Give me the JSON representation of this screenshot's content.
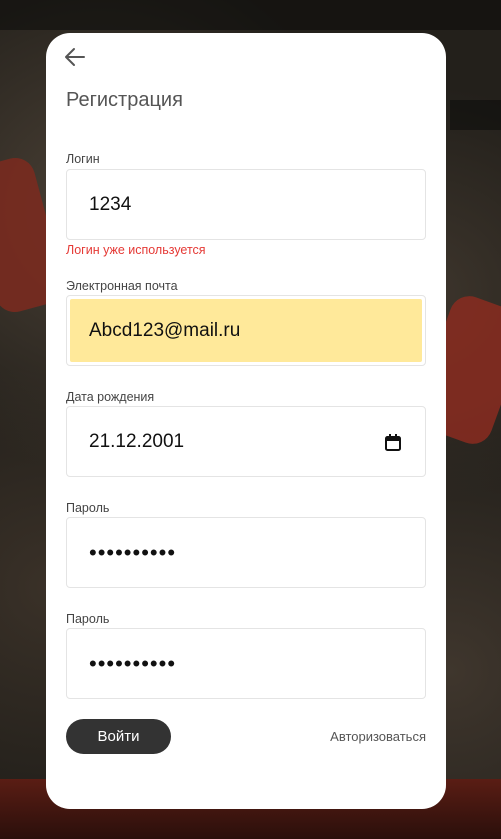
{
  "form": {
    "title": "Регистрация",
    "login": {
      "label": "Логин",
      "value": "1234",
      "error": "Логин уже используется"
    },
    "email": {
      "label": "Электронная почта",
      "value": "Abcd123@mail.ru"
    },
    "birthdate": {
      "label": "Дата рождения",
      "value": "21.12.2001"
    },
    "password": {
      "label": "Пароль",
      "masked": "••••••••••"
    },
    "password_confirm": {
      "label": "Пароль",
      "masked": "••••••••••"
    },
    "submit_label": "Войти",
    "auth_link": "Авторизоваться"
  },
  "icons": {
    "back": "arrow-left-icon",
    "calendar": "calendar-icon"
  },
  "colors": {
    "error": "#e53935",
    "autofill": "#ffe99a",
    "button": "#333333"
  }
}
